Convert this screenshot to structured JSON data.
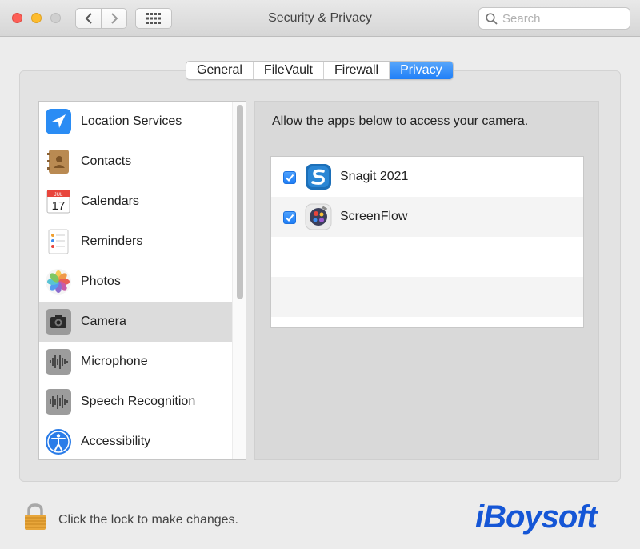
{
  "window": {
    "title": "Security & Privacy"
  },
  "search": {
    "placeholder": "Search"
  },
  "tabs": [
    {
      "label": "General",
      "active": false
    },
    {
      "label": "FileVault",
      "active": false
    },
    {
      "label": "Firewall",
      "active": false
    },
    {
      "label": "Privacy",
      "active": true
    }
  ],
  "sidebar": {
    "selected": "Camera",
    "items": [
      {
        "label": "Location Services",
        "icon": "location-arrow-icon"
      },
      {
        "label": "Contacts",
        "icon": "contacts-book-icon"
      },
      {
        "label": "Calendars",
        "icon": "calendar-icon"
      },
      {
        "label": "Reminders",
        "icon": "reminders-icon"
      },
      {
        "label": "Photos",
        "icon": "photos-icon"
      },
      {
        "label": "Camera",
        "icon": "camera-icon"
      },
      {
        "label": "Microphone",
        "icon": "microphone-waveform-icon"
      },
      {
        "label": "Speech Recognition",
        "icon": "speech-waveform-icon"
      },
      {
        "label": "Accessibility",
        "icon": "accessibility-icon"
      }
    ],
    "calendar_icon": {
      "month": "JUL",
      "day": "17"
    }
  },
  "camera_pane": {
    "description": "Allow the apps below to access your camera.",
    "apps": [
      {
        "name": "Snagit 2021",
        "checked": true,
        "icon": "snagit-icon"
      },
      {
        "name": "ScreenFlow",
        "checked": true,
        "icon": "screenflow-icon"
      }
    ]
  },
  "footer": {
    "lock_text": "Click the lock to make changes."
  },
  "watermark": {
    "text": "iBoysoft"
  },
  "colors": {
    "accent": "#1f7ff7",
    "watermark": "#1556d6",
    "close": "#fd5f57",
    "minimize": "#fdbc2e"
  }
}
